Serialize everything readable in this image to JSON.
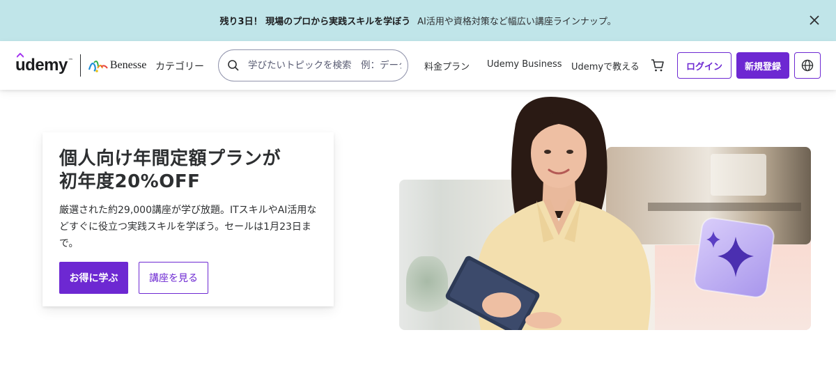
{
  "promo": {
    "headline": "残り3日！ 現場のプロから実践スキルを学ぼう",
    "text": "AI活用や資格対策など幅広い講座ラインナップ。",
    "close_icon": "close-icon"
  },
  "header": {
    "logo_text": "udemy",
    "logo_tm": "™",
    "partner_text": "Benesse",
    "category": "カテゴリー",
    "search_placeholder": "学びたいトピックを検索　例：データ分析",
    "nav": {
      "pricing": "料金プラン",
      "business": "Udemy Business",
      "teach": "Udemyで教える"
    },
    "cart_icon": "cart-icon",
    "login": "ログイン",
    "signup": "新規登録",
    "language_icon": "globe-icon"
  },
  "hero": {
    "title_line1": "個人向け年間定額プランが",
    "title_line2": "初年度20%OFF",
    "body": "厳選された約29,000講座が学び放題。ITスキルやAI活用などすぐに役立つ実践スキルを学ぼう。セールは1月23日まで。",
    "primary_button": "お得に学ぶ",
    "secondary_button": "講座を見る"
  },
  "colors": {
    "brand": "#6d28d2",
    "promo_bg": "#c0e5e9",
    "text": "#2d2f31"
  }
}
